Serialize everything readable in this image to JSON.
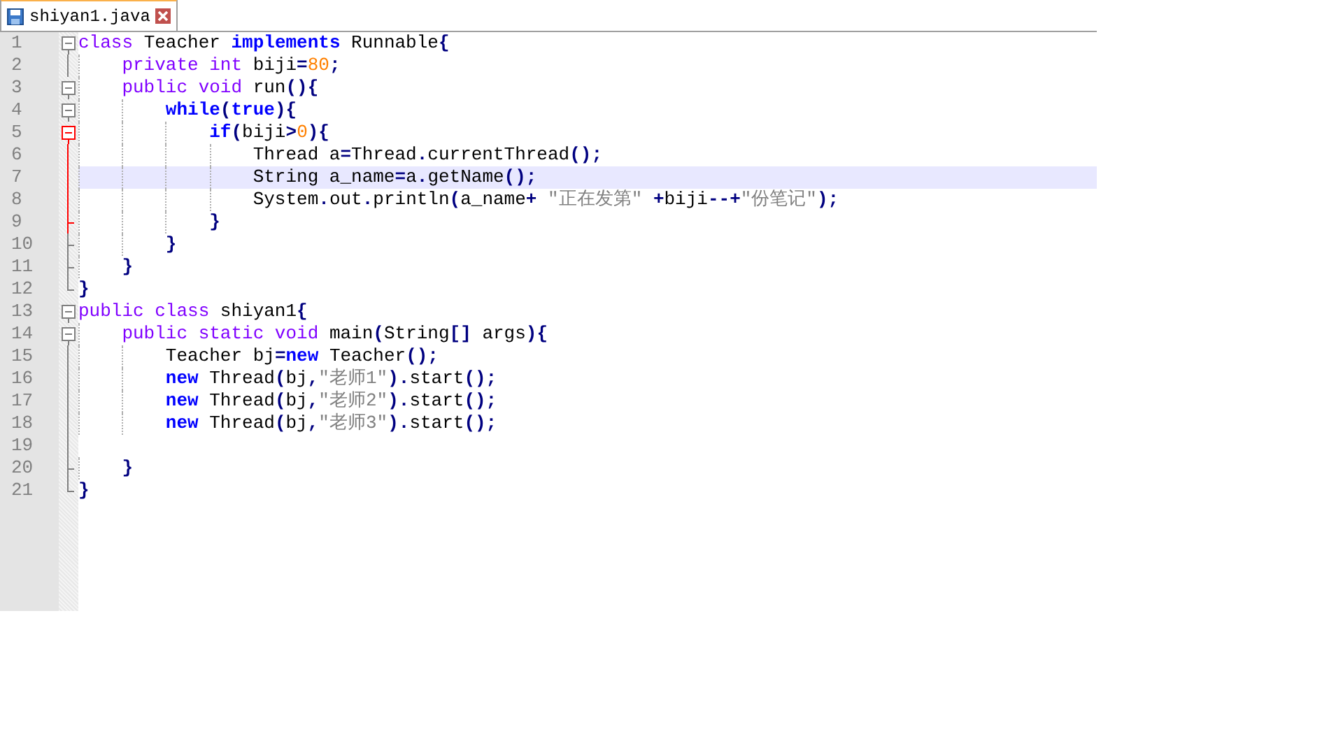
{
  "tab": {
    "title": "shiyan1.java",
    "selected": true
  },
  "lines": [
    {
      "number": "1",
      "kind": "fold-start",
      "active": false,
      "current": false,
      "tokens": [
        {
          "kind": "type",
          "text": "class"
        },
        {
          "kind": "plain",
          "text": " Teacher "
        },
        {
          "kind": "keyword",
          "text": "implements"
        },
        {
          "kind": "plain",
          "text": " Runnable"
        },
        {
          "kind": "operator",
          "text": "{"
        }
      ]
    },
    {
      "number": "2",
      "kind": "fold-body",
      "active": false,
      "current": false,
      "tokens": [
        {
          "kind": "type",
          "text": "    private int"
        },
        {
          "kind": "plain",
          "text": " biji"
        },
        {
          "kind": "operator",
          "text": "="
        },
        {
          "kind": "number",
          "text": "80"
        },
        {
          "kind": "operator",
          "text": ";"
        }
      ]
    },
    {
      "number": "3",
      "kind": "fold-start",
      "active": false,
      "current": false,
      "tokens": [
        {
          "kind": "type",
          "text": "    public void"
        },
        {
          "kind": "plain",
          "text": " run"
        },
        {
          "kind": "operator",
          "text": "(){"
        }
      ]
    },
    {
      "number": "4",
      "kind": "fold-start",
      "active": false,
      "current": false,
      "tokens": [
        {
          "kind": "keyword",
          "text": "        while"
        },
        {
          "kind": "operator",
          "text": "("
        },
        {
          "kind": "keyword",
          "text": "true"
        },
        {
          "kind": "operator",
          "text": "){"
        }
      ]
    },
    {
      "number": "5",
      "kind": "fold-start",
      "active": true,
      "current": false,
      "tokens": [
        {
          "kind": "keyword",
          "text": "            if"
        },
        {
          "kind": "operator",
          "text": "("
        },
        {
          "kind": "plain",
          "text": "biji"
        },
        {
          "kind": "operator",
          "text": ">"
        },
        {
          "kind": "number",
          "text": "0"
        },
        {
          "kind": "operator",
          "text": "){"
        }
      ]
    },
    {
      "number": "6",
      "kind": "fold-body",
      "active": true,
      "current": false,
      "tokens": [
        {
          "kind": "plain",
          "text": "                Thread a"
        },
        {
          "kind": "operator",
          "text": "="
        },
        {
          "kind": "plain",
          "text": "Thread"
        },
        {
          "kind": "operator",
          "text": "."
        },
        {
          "kind": "plain",
          "text": "currentThread"
        },
        {
          "kind": "operator",
          "text": "();"
        }
      ]
    },
    {
      "number": "7",
      "kind": "fold-body",
      "active": true,
      "current": true,
      "tokens": [
        {
          "kind": "plain",
          "text": "                String a_name"
        },
        {
          "kind": "operator",
          "text": "="
        },
        {
          "kind": "plain",
          "text": "a"
        },
        {
          "kind": "operator",
          "text": "."
        },
        {
          "kind": "plain",
          "text": "getName"
        },
        {
          "kind": "operator",
          "text": "();"
        }
      ]
    },
    {
      "number": "8",
      "kind": "fold-body",
      "active": true,
      "current": false,
      "tokens": [
        {
          "kind": "plain",
          "text": "                System"
        },
        {
          "kind": "operator",
          "text": "."
        },
        {
          "kind": "plain",
          "text": "out"
        },
        {
          "kind": "operator",
          "text": "."
        },
        {
          "kind": "plain",
          "text": "println"
        },
        {
          "kind": "operator",
          "text": "("
        },
        {
          "kind": "plain",
          "text": "a_name"
        },
        {
          "kind": "operator",
          "text": "+"
        },
        {
          "kind": "string",
          "text": " \"正在发第\" "
        },
        {
          "kind": "operator",
          "text": "+"
        },
        {
          "kind": "plain",
          "text": "biji"
        },
        {
          "kind": "operator",
          "text": "--+"
        },
        {
          "kind": "string",
          "text": "\"份笔记\""
        },
        {
          "kind": "operator",
          "text": ");"
        }
      ]
    },
    {
      "number": "9",
      "kind": "fold-end",
      "active": true,
      "current": false,
      "tokens": [
        {
          "kind": "operator",
          "text": "            }"
        }
      ]
    },
    {
      "number": "10",
      "kind": "fold-end",
      "active": false,
      "current": false,
      "tokens": [
        {
          "kind": "operator",
          "text": "        }"
        }
      ]
    },
    {
      "number": "11",
      "kind": "fold-end",
      "active": false,
      "current": false,
      "tokens": [
        {
          "kind": "operator",
          "text": "    }"
        }
      ]
    },
    {
      "number": "12",
      "kind": "fold-last",
      "active": false,
      "current": false,
      "tokens": [
        {
          "kind": "operator",
          "text": "}"
        }
      ]
    },
    {
      "number": "13",
      "kind": "fold-start",
      "active": false,
      "current": false,
      "tokens": [
        {
          "kind": "type",
          "text": "public class"
        },
        {
          "kind": "plain",
          "text": " shiyan1"
        },
        {
          "kind": "operator",
          "text": "{"
        }
      ]
    },
    {
      "number": "14",
      "kind": "fold-start",
      "active": false,
      "current": false,
      "tokens": [
        {
          "kind": "type",
          "text": "    public static void"
        },
        {
          "kind": "plain",
          "text": " main"
        },
        {
          "kind": "operator",
          "text": "("
        },
        {
          "kind": "plain",
          "text": "String"
        },
        {
          "kind": "operator",
          "text": "[]"
        },
        {
          "kind": "plain",
          "text": " args"
        },
        {
          "kind": "operator",
          "text": "){"
        }
      ]
    },
    {
      "number": "15",
      "kind": "fold-body",
      "active": false,
      "current": false,
      "tokens": [
        {
          "kind": "plain",
          "text": "        Teacher bj"
        },
        {
          "kind": "operator",
          "text": "="
        },
        {
          "kind": "keyword",
          "text": "new"
        },
        {
          "kind": "plain",
          "text": " Teacher"
        },
        {
          "kind": "operator",
          "text": "();"
        }
      ]
    },
    {
      "number": "16",
      "kind": "fold-body",
      "active": false,
      "current": false,
      "tokens": [
        {
          "kind": "keyword",
          "text": "        new"
        },
        {
          "kind": "plain",
          "text": " Thread"
        },
        {
          "kind": "operator",
          "text": "("
        },
        {
          "kind": "plain",
          "text": "bj"
        },
        {
          "kind": "operator",
          "text": ","
        },
        {
          "kind": "string",
          "text": "\"老师1\""
        },
        {
          "kind": "operator",
          "text": ")."
        },
        {
          "kind": "plain",
          "text": "start"
        },
        {
          "kind": "operator",
          "text": "();"
        }
      ]
    },
    {
      "number": "17",
      "kind": "fold-body",
      "active": false,
      "current": false,
      "tokens": [
        {
          "kind": "keyword",
          "text": "        new"
        },
        {
          "kind": "plain",
          "text": " Thread"
        },
        {
          "kind": "operator",
          "text": "("
        },
        {
          "kind": "plain",
          "text": "bj"
        },
        {
          "kind": "operator",
          "text": ","
        },
        {
          "kind": "string",
          "text": "\"老师2\""
        },
        {
          "kind": "operator",
          "text": ")."
        },
        {
          "kind": "plain",
          "text": "start"
        },
        {
          "kind": "operator",
          "text": "();"
        }
      ]
    },
    {
      "number": "18",
      "kind": "fold-body",
      "active": false,
      "current": false,
      "tokens": [
        {
          "kind": "keyword",
          "text": "        new"
        },
        {
          "kind": "plain",
          "text": " Thread"
        },
        {
          "kind": "operator",
          "text": "("
        },
        {
          "kind": "plain",
          "text": "bj"
        },
        {
          "kind": "operator",
          "text": ","
        },
        {
          "kind": "string",
          "text": "\"老师3\""
        },
        {
          "kind": "operator",
          "text": ")."
        },
        {
          "kind": "plain",
          "text": "start"
        },
        {
          "kind": "operator",
          "text": "();"
        }
      ]
    },
    {
      "number": "19",
      "kind": "fold-body",
      "active": false,
      "current": false
    },
    {
      "number": "20",
      "kind": "fold-end",
      "active": false,
      "current": false,
      "tokens": [
        {
          "kind": "operator",
          "text": "    }"
        }
      ]
    },
    {
      "number": "21",
      "kind": "fold-last",
      "active": false,
      "current": false,
      "tokens": [
        {
          "kind": "operator",
          "text": "}"
        }
      ]
    }
  ]
}
